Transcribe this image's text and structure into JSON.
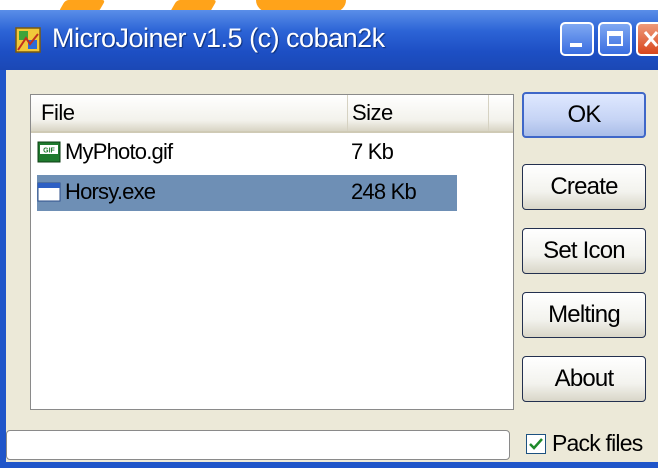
{
  "window": {
    "title": "MicroJoiner v1.5 (c) coban2k"
  },
  "file_list": {
    "columns": [
      {
        "label": "File"
      },
      {
        "label": "Size"
      }
    ],
    "rows": [
      {
        "name": "MyPhoto.gif",
        "size": "7 Kb",
        "icon": "gif-file-icon",
        "selected": false
      },
      {
        "name": "Horsy.exe",
        "size": "248 Kb",
        "icon": "exe-file-icon",
        "selected": true
      }
    ]
  },
  "buttons": {
    "ok": "OK",
    "create": "Create",
    "set_icon": "Set Icon",
    "melting": "Melting",
    "about": "About"
  },
  "options": {
    "pack_files_label": "Pack files",
    "pack_files_checked": true
  },
  "progress": {
    "value": 0
  },
  "colors": {
    "titlebar": "#2c64d6",
    "selection": "#6e8fb5",
    "dialog_bg": "#ece9d8"
  }
}
